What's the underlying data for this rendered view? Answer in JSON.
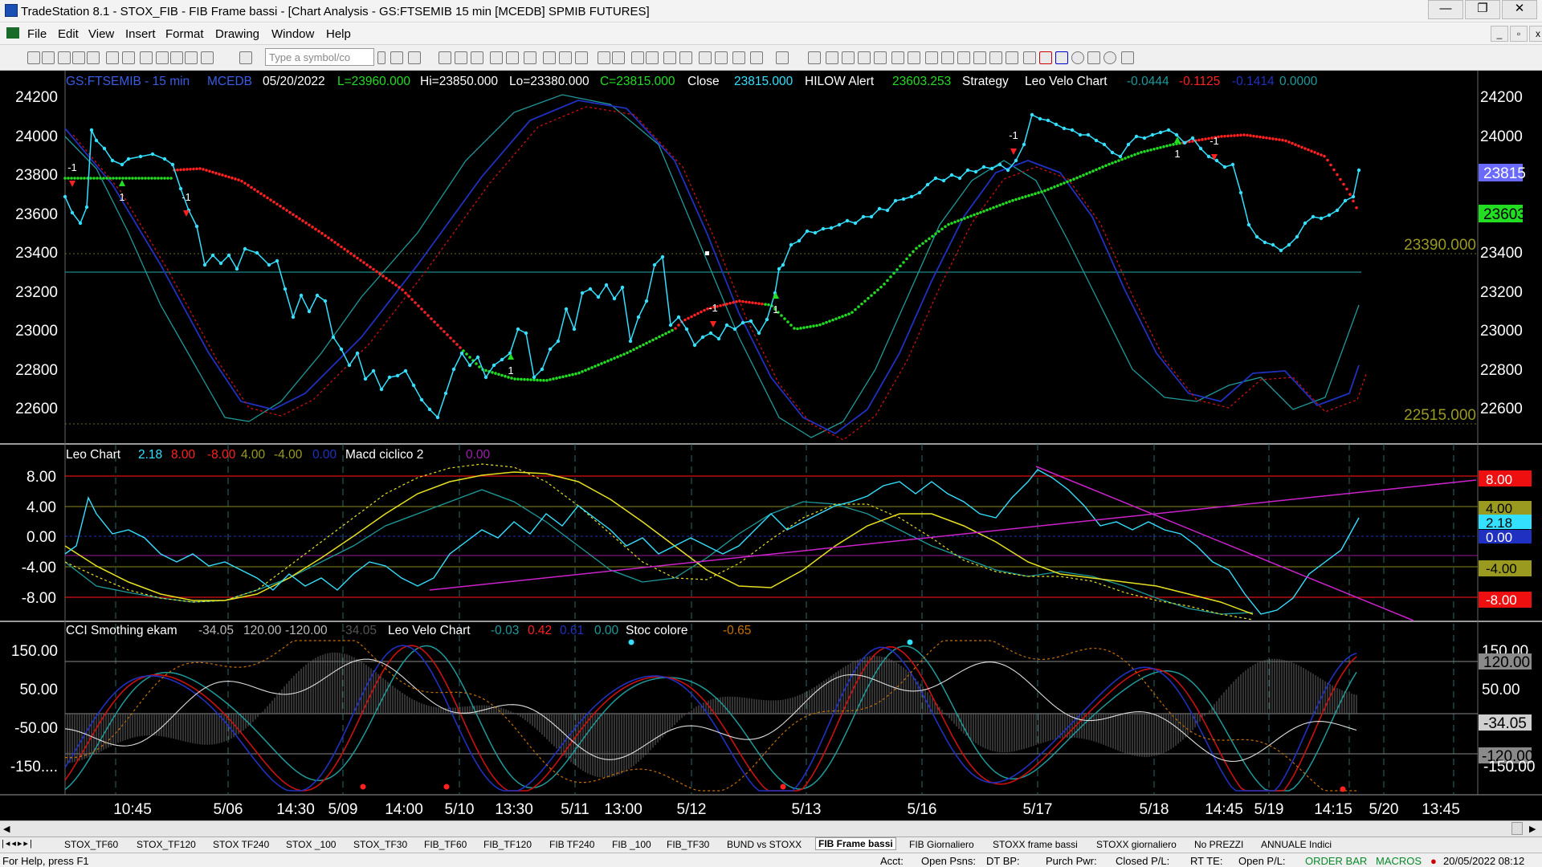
{
  "window": {
    "title": "TradeStation 8.1 - STOX_FIB - FIB Frame bassi - [Chart Analysis - GS:FTSEMIB  15 min  [MCEDB] SPMIB FUTURES]",
    "minimize": "—",
    "maximize": "❐",
    "close": "✕"
  },
  "menu": [
    "File",
    "Edit",
    "View",
    "Insert",
    "Format",
    "Drawing",
    "Window",
    "Help"
  ],
  "toolbar": {
    "symbol_placeholder": "Type a symbol/co"
  },
  "price_header": {
    "symbol": "GS:FTSEMIB - 15 min",
    "source": "MCEDB",
    "date": "05/20/2022",
    "low_text": "L=23960.000",
    "hi_text": "Hi=23850.000",
    "lo_text": "Lo=23380.000",
    "close_text": "C=23815.000",
    "close_label": "Close",
    "close_value": "23815.000",
    "hilow_label": "HILOW Alert",
    "hilow_value": "23603.253",
    "strategy": "Strategy",
    "leo_label": "Leo Velo Chart",
    "v1": "-0.0444",
    "v2": "-0.1125",
    "v3": "-0.1414",
    "v4": "0.0000"
  },
  "osc_header": {
    "label": "Leo Chart",
    "v1": "2.18",
    "v2": "8.00",
    "v3": "-8.00",
    "v4": "4.00",
    "v5": "-4.00",
    "v6": "0.00",
    "label2": "Macd ciclico 2",
    "v7": "0.00"
  },
  "cci_header": {
    "label": "CCI Smothing ekam",
    "v1": "-34.05",
    "v2": "120.00",
    "v3": "-120.00",
    "v4": "-34.05",
    "label2": "Leo Velo Chart",
    "w1": "-0.03",
    "w2": "0.42",
    "w3": "0.61",
    "w4": "0.00",
    "label3": "Stoc colore",
    "w5": "-0.65"
  },
  "price_axis": [
    "24200",
    "24000",
    "23800",
    "23600",
    "23400",
    "23200",
    "23000",
    "22800",
    "22600"
  ],
  "price_tags": {
    "close": "23815",
    "hilow": "23603"
  },
  "price_levels": {
    "upper": "23390.000",
    "lower": "22515.000"
  },
  "osc_axis": [
    "8.00",
    "4.00",
    "0.00",
    "-4.00",
    "-8.00"
  ],
  "osc_tags": [
    "8.00",
    "4.00",
    "2.18",
    "0.00",
    "-4.00",
    "-8.00"
  ],
  "cci_axis": [
    "150.00",
    "50.00",
    "-50.00",
    "-150...."
  ],
  "cci_right": [
    "150.00",
    "120.00",
    "50.00",
    "-34.05",
    "-120.00",
    "-150.00"
  ],
  "time_axis": [
    "10:45",
    "5/06",
    "14:30",
    "5/09",
    "14:00",
    "5/10",
    "13:30",
    "5/11",
    "13:00",
    "5/12",
    "5/13",
    "5/16",
    "5/17",
    "5/18",
    "14:45",
    "5/19",
    "14:15",
    "5/20",
    "13:45"
  ],
  "signals": [
    "-1",
    "1",
    "-1",
    "-1",
    "1",
    "1",
    "-1",
    "1",
    "-1"
  ],
  "tabs": [
    "STOX_TF60",
    "STOX_TF120",
    "STOX TF240",
    "STOX _100",
    "STOX_TF30",
    "FIB_TF60",
    "FIB_TF120",
    "FIB TF240",
    "FIB _100",
    "FIB_TF30",
    "BUND vs STOXX",
    "FIB Frame bassi",
    "FIB Giornaliero",
    "STOXX frame bassi",
    "STOXX giornaliero",
    "No PREZZI",
    "ANNUALE Indici"
  ],
  "status": {
    "help": "For Help, press F1",
    "acct": "Acct:",
    "open_psns": "Open Psns:",
    "dt_bp": "DT BP:",
    "purch": "Purch Pwr:",
    "closed": "Closed P/L:",
    "rt_te": "RT TE:",
    "open_pl": "Open P/L:",
    "order_bar": "ORDER BAR",
    "macros": "MACROS",
    "datetime": "20/05/2022 08:12"
  },
  "colors": {
    "up": "#22dd22",
    "down": "#ff2020",
    "price": "#33e0ff",
    "magenta": "#cc22cc",
    "yellow": "#e6e020",
    "navy": "#2030c0"
  }
}
